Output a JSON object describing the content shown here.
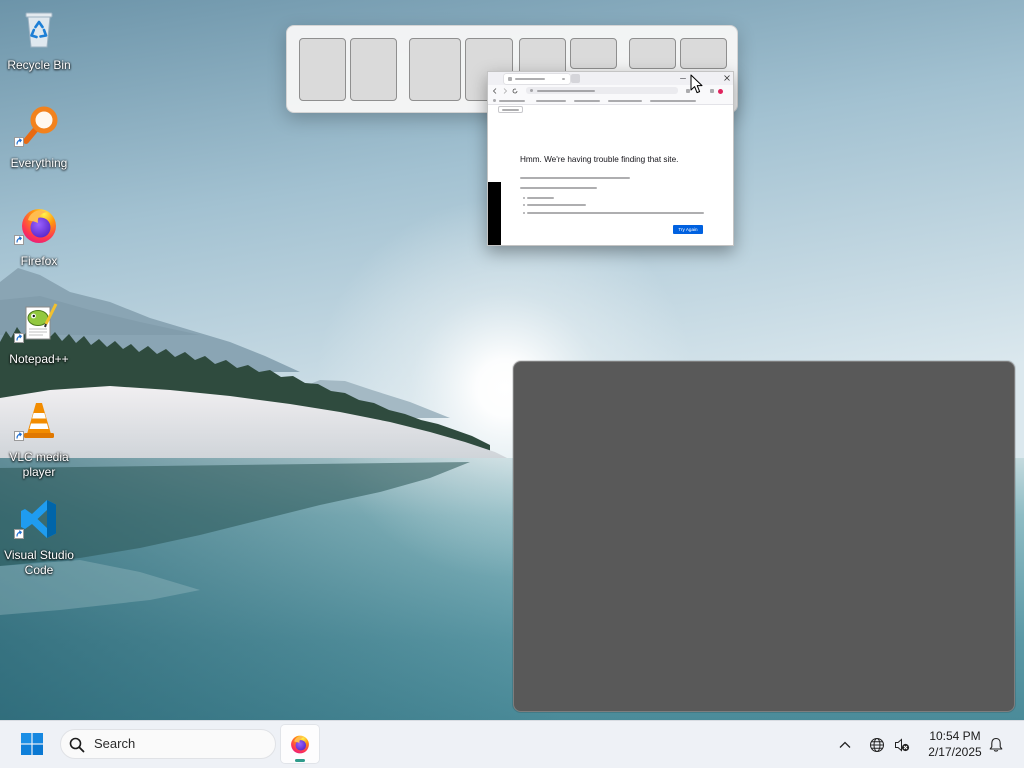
{
  "colors": {
    "accent": "#0078d4",
    "taskbar_indicator": "#2f9c8c",
    "snap_preview": "#595959",
    "error_button": "#0061e0"
  },
  "desktop": {
    "icons": [
      {
        "label": "Recycle Bin",
        "icon": "recycle-bin-icon",
        "shortcut": false
      },
      {
        "label": "Everything",
        "icon": "everything-icon",
        "shortcut": true
      },
      {
        "label": "Firefox",
        "icon": "firefox-icon",
        "shortcut": true
      },
      {
        "label": "Notepad++",
        "icon": "notepad-plus-plus-icon",
        "shortcut": true
      },
      {
        "label": "VLC media player",
        "icon": "vlc-icon",
        "shortcut": true
      },
      {
        "label": "Visual Studio Code",
        "icon": "vscode-icon",
        "shortcut": true
      }
    ]
  },
  "browser_window": {
    "error_heading": "Hmm. We're having trouble finding that site.",
    "try_again_label": "Try Again"
  },
  "taskbar": {
    "start_icon": "windows-start-icon",
    "search_placeholder": "Search",
    "pinned": [
      {
        "icon": "firefox-icon",
        "active": true
      }
    ],
    "tray_icons": [
      "chevron-up-icon",
      "globe-icon",
      "volume-muted-icon",
      "bell-icon"
    ],
    "clock": {
      "time": "10:54 PM",
      "date": "2/17/2025"
    }
  },
  "cursor": {
    "icon": "arrow-cursor-icon"
  }
}
